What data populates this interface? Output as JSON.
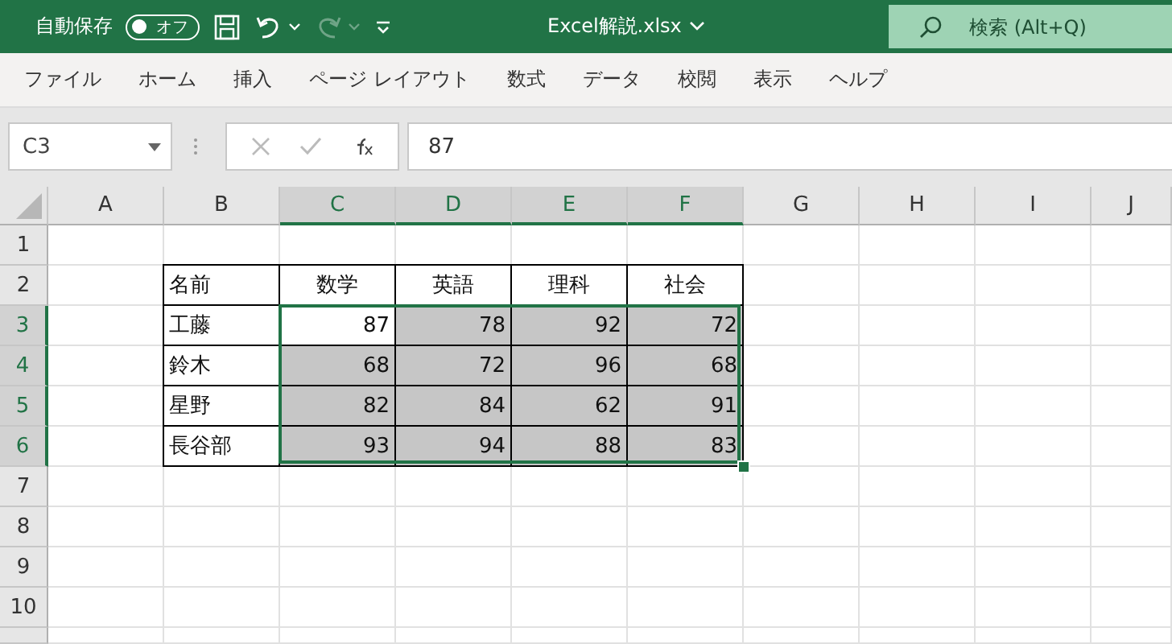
{
  "title_bar": {
    "autosave_label": "自動保存",
    "autosave_toggle": {
      "on": false,
      "label": "オフ"
    },
    "redo": {
      "disabled": true
    },
    "file_name": "Excel解説.xlsx",
    "search": {
      "placeholder": "検索 (Alt+Q)"
    }
  },
  "ribbon_tabs": [
    "ファイル",
    "ホーム",
    "挿入",
    "ページ レイアウト",
    "数式",
    "データ",
    "校閲",
    "表示",
    "ヘルプ"
  ],
  "formula_bar": {
    "name_box": "C3",
    "formula": "87"
  },
  "sheet": {
    "columns": [
      {
        "label": "A",
        "selected": false
      },
      {
        "label": "B",
        "selected": false
      },
      {
        "label": "C",
        "selected": true
      },
      {
        "label": "D",
        "selected": true
      },
      {
        "label": "E",
        "selected": true
      },
      {
        "label": "F",
        "selected": true
      },
      {
        "label": "G",
        "selected": false
      },
      {
        "label": "H",
        "selected": false
      },
      {
        "label": "I",
        "selected": false
      },
      {
        "label": "J",
        "selected": false
      }
    ],
    "rows": [
      {
        "label": "1",
        "selected": false
      },
      {
        "label": "2",
        "selected": false
      },
      {
        "label": "3",
        "selected": true
      },
      {
        "label": "4",
        "selected": true
      },
      {
        "label": "5",
        "selected": true
      },
      {
        "label": "6",
        "selected": true
      },
      {
        "label": "7",
        "selected": false
      },
      {
        "label": "8",
        "selected": false
      },
      {
        "label": "9",
        "selected": false
      },
      {
        "label": "10",
        "selected": false
      }
    ],
    "table": {
      "header": [
        "名前",
        "数学",
        "英語",
        "理科",
        "社会"
      ],
      "rows": [
        {
          "name": "工藤",
          "scores": [
            {
              "text": "87",
              "selected": true,
              "active": true
            },
            {
              "text": "78",
              "selected": true,
              "active": false
            },
            {
              "text": "92",
              "selected": true,
              "active": false
            },
            {
              "text": "72",
              "selected": true,
              "active": false
            }
          ]
        },
        {
          "name": "鈴木",
          "scores": [
            {
              "text": "68",
              "selected": true,
              "active": false
            },
            {
              "text": "72",
              "selected": true,
              "active": false
            },
            {
              "text": "96",
              "selected": true,
              "active": false
            },
            {
              "text": "68",
              "selected": true,
              "active": false
            }
          ]
        },
        {
          "name": "星野",
          "scores": [
            {
              "text": "82",
              "selected": true,
              "active": false
            },
            {
              "text": "84",
              "selected": true,
              "active": false
            },
            {
              "text": "62",
              "selected": true,
              "active": false
            },
            {
              "text": "91",
              "selected": true,
              "active": false
            }
          ]
        },
        {
          "name": "長谷部",
          "scores": [
            {
              "text": "93",
              "selected": true,
              "active": false
            },
            {
              "text": "94",
              "selected": true,
              "active": false
            },
            {
              "text": "88",
              "selected": true,
              "active": false
            },
            {
              "text": "83",
              "selected": true,
              "active": false
            }
          ]
        }
      ]
    }
  }
}
